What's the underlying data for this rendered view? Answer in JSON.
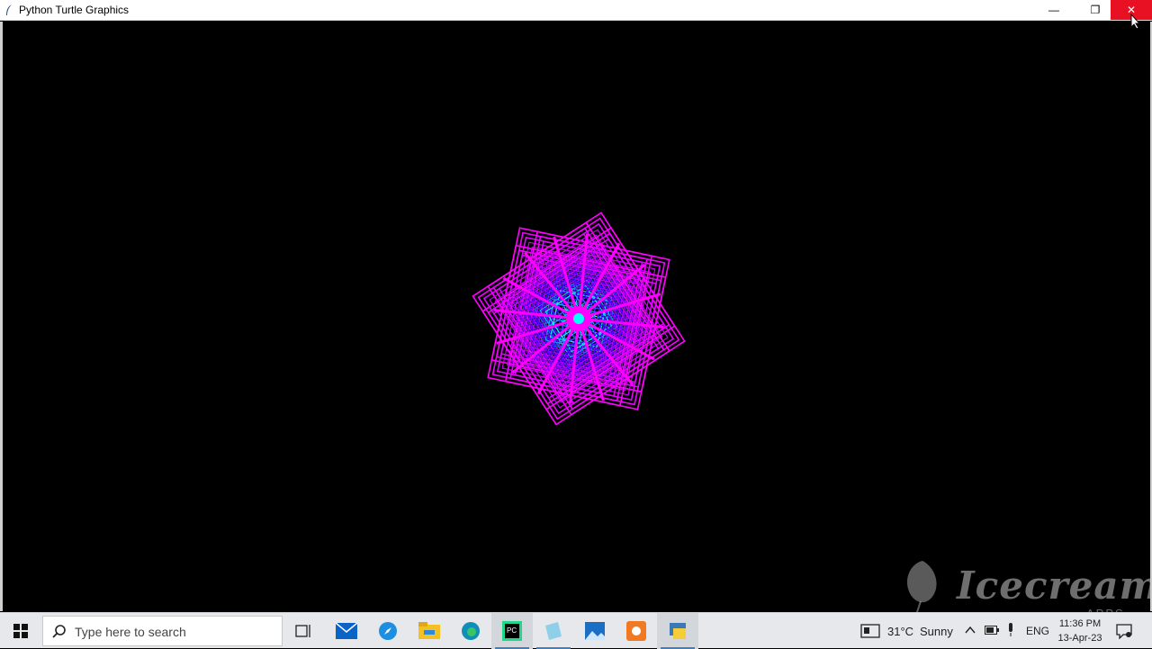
{
  "window": {
    "title": "Python Turtle Graphics",
    "canvas_background": "#000000",
    "close_color": "#e81123"
  },
  "controls": {
    "minimize": "—",
    "restore": "❐",
    "close": "✕"
  },
  "drawing": {
    "description_colors": [
      "#ff00ff",
      "#c000ff",
      "#3a00ff",
      "#00ffff"
    ],
    "icon": "turtle-spirograph"
  },
  "watermark": {
    "text": "Icecream",
    "sub": "APPS"
  },
  "taskbar": {
    "search_placeholder": "Type here to search",
    "weather_temp": "31°C",
    "weather_text": "Sunny",
    "language": "ENG",
    "time": "11:36 PM",
    "date": "13-Apr-23",
    "apps": [
      "task-view-icon",
      "mail-icon",
      "safari-icon",
      "file-explorer-icon",
      "edge-icon",
      "pycharm-icon",
      "notepad-icon",
      "photos-icon",
      "app-icon",
      "python-icon"
    ]
  }
}
